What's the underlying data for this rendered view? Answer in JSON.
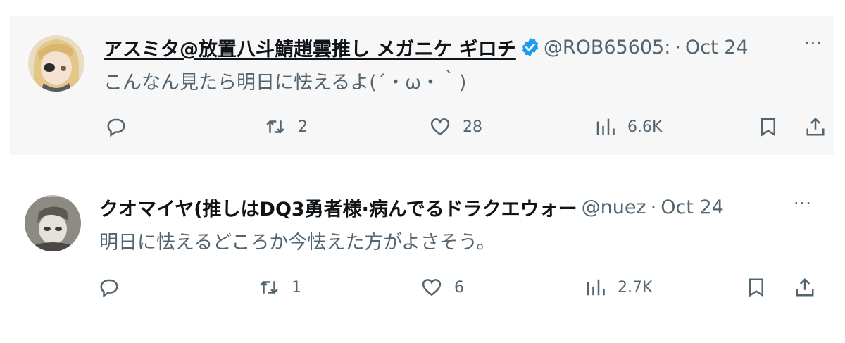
{
  "tweets": [
    {
      "name": "アスミタ@放置八斗鯖趙雲推し メガニケ ギロチ",
      "verified": true,
      "handle": "@ROB65605:",
      "separator": "·",
      "date": "Oct 24",
      "text": "こんなん見たら明日に怯えるよ(´・ω・｀)",
      "retweets": "2",
      "likes": "28",
      "views": "6.6K"
    },
    {
      "name": "クオマイヤ(推しはDQ3勇者様·病んでるドラクエウォー",
      "verified": false,
      "handle": "@nuez",
      "separator": "·",
      "date": "Oct 24",
      "text": "明日に怯えるどころか今怯えた方がよさそう。",
      "retweets": "1",
      "likes": "6",
      "views": "2.7K"
    }
  ],
  "more_label": "···",
  "colors": {
    "verified": "#1d9bf0",
    "secondary": "#536471",
    "highlight_bg": "#f7f7f7"
  }
}
